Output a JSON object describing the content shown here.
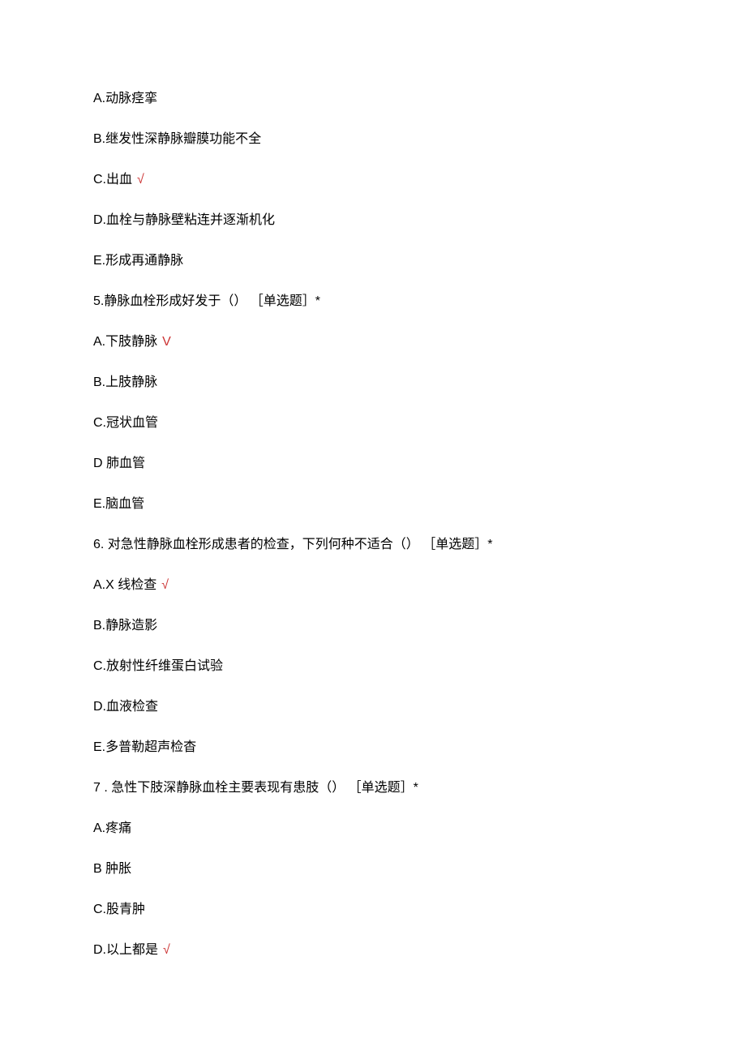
{
  "q4options": {
    "a": "A.动脉痉挛",
    "b": "B.继发性深静脉瓣膜功能不全",
    "c": "C.出血",
    "c_mark": "√",
    "d": "D.血栓与静脉壁粘连并逐渐机化",
    "e": "E.形成再通静脉"
  },
  "q5": {
    "stem": "5.静脉血栓形成好发于（） ［单选题］*",
    "a": "A.下肢静脉",
    "a_mark": "V",
    "b": "B.上肢静脉",
    "c": "C.冠状血管",
    "d": "D 肺血管",
    "e": "E.脑血管"
  },
  "q6": {
    "stem": "6. 对急性静脉血栓形成患者的检查，下列何种不适合（） ［单选题］*",
    "a": "A.X 线检查",
    "a_mark": "√",
    "b": "B.静脉造影",
    "c": "C.放射性纤维蛋白试验",
    "d": "D.血液检查",
    "e": "E.多普勒超声检杳"
  },
  "q7": {
    "stem": "7   . 急性下肢深静脉血栓主要表现有患肢（） ［单选题］*",
    "a": "A.疼痛",
    "b": "B 肿胀",
    "c": "C.股青肿",
    "d": "D.以上都是",
    "d_mark": "√"
  }
}
